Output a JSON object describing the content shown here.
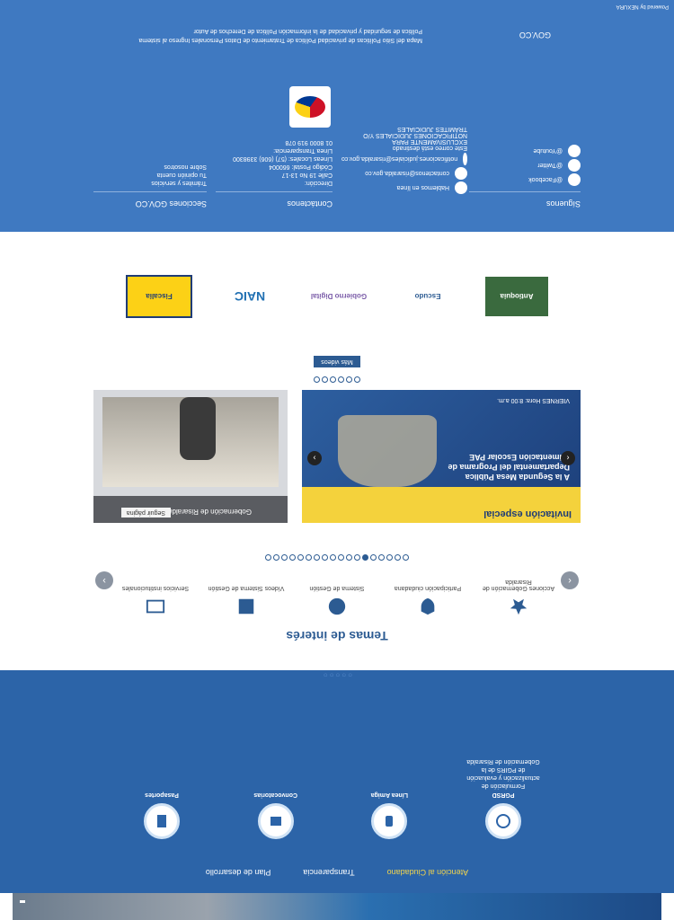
{
  "topnav": [
    "Atención al Ciudadano",
    "Transparencia",
    "Plan de desarrollo"
  ],
  "services": [
    {
      "title": "PGRSD",
      "desc": "Formulación de actualización y evaluación de PGIRS de la Gobernación de Risaralda",
      "icon": "recycle-icon"
    },
    {
      "title": "Línea Amiga",
      "desc": "",
      "icon": "phone-icon"
    },
    {
      "title": "Convocatorias",
      "desc": "",
      "icon": "megaphone-icon"
    },
    {
      "title": "Pasaportes",
      "desc": "",
      "icon": "passport-icon"
    }
  ],
  "temas": {
    "title": "Temas de interés",
    "items": [
      {
        "label": "Acciones Gobernación de Risaralda",
        "icon": "star-icon"
      },
      {
        "label": "Participación ciudadana",
        "icon": "shield-icon"
      },
      {
        "label": "Sistema de Gestión",
        "icon": "globe-icon"
      },
      {
        "label": "Vídeos Sistema de Gestión",
        "icon": "film-icon"
      },
      {
        "label": "Servicios institucionales",
        "icon": "table-icon"
      }
    ]
  },
  "video": {
    "banner": "Invitación especial",
    "body": "A la Segunda Mesa Pública Departamental del Programa de Alimentación Escolar PAE",
    "foot": "VIERNES  Hora: 8:00 a.m."
  },
  "facebook": {
    "name": "Gobernación de Risaralda",
    "button": "Seguir página"
  },
  "more_button": "Más videos",
  "logos": [
    "Fiscalía",
    "NAIC",
    "Gobierno Digital",
    "Escudo",
    "Antioquia"
  ],
  "footer": {
    "col1_title": "Secciones GOV.CO",
    "col1_items": [
      "Trámites y servicios",
      "Tu opinión cuenta",
      "Sobre nosotros"
    ],
    "col2_title": "Contáctenos",
    "col2_items": [
      "Dirección:",
      "Calle 19 No 13-17",
      "Código Postal: 660004",
      "Líneas Locales: (57) (606) 3398300",
      "Línea Transparencia:",
      "01 8000 919 078"
    ],
    "col3_items": [
      "Hablemos en línea",
      "contactenos@risaralda.gov.co",
      "notificaciones.judiciales@risaralda.gov.co",
      "Este correo está destinado EXCLUSIVAMENTE PARA NOTIFICACIONES JUDICIALES Y/O TRÁMITES JUDICIALES"
    ],
    "col4_title": "Síguenos",
    "col4_items": [
      "@Facebook",
      "@Twitter",
      "@Youtube"
    ],
    "links1": "Mapa del Sitio  Políticas de privacidad  Política de Tratamiento de Datos Personales  Ingreso al sistema",
    "links2": "Política de seguridad y privacidad de la información   Política de Derechos de Autor",
    "govco": "GOV.CO",
    "copyright": "Powered by NEXURA"
  }
}
